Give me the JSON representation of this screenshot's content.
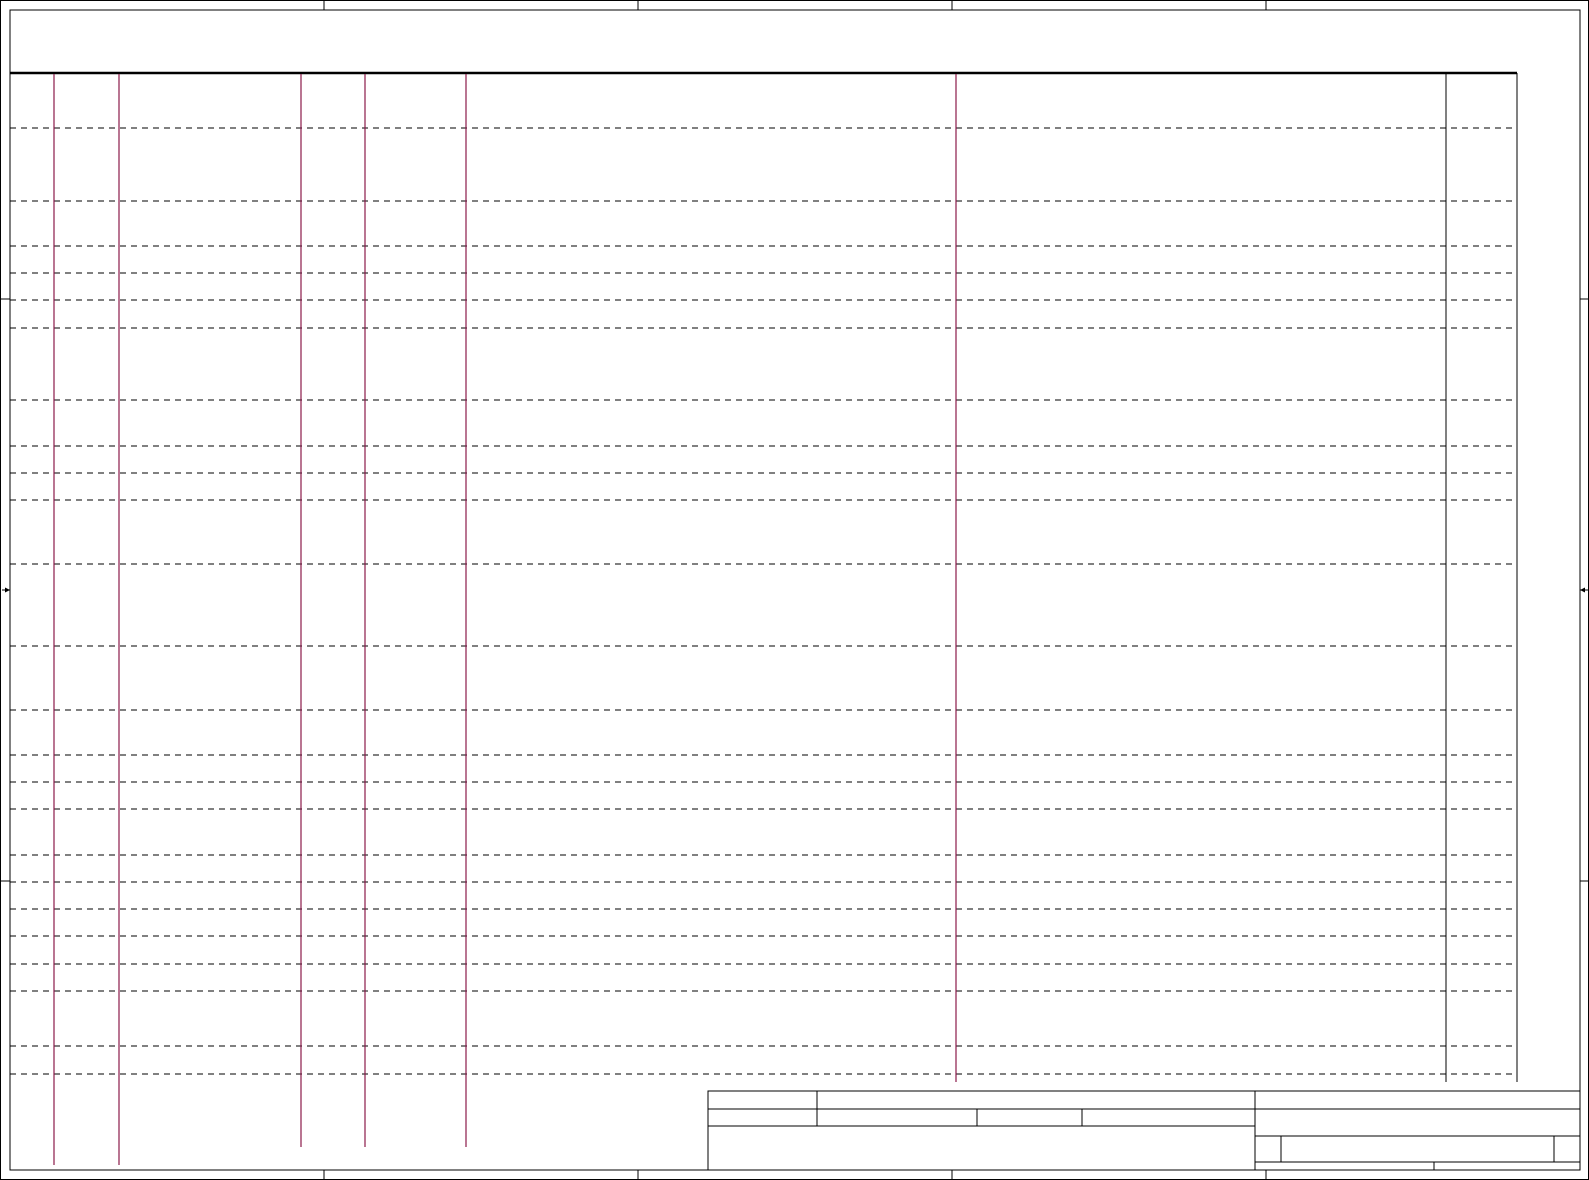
{
  "sheet": {
    "background": "#ffffff",
    "line_color": "#000000",
    "column_line_color": "#8b1a4a",
    "title_block": {
      "cells": []
    }
  }
}
